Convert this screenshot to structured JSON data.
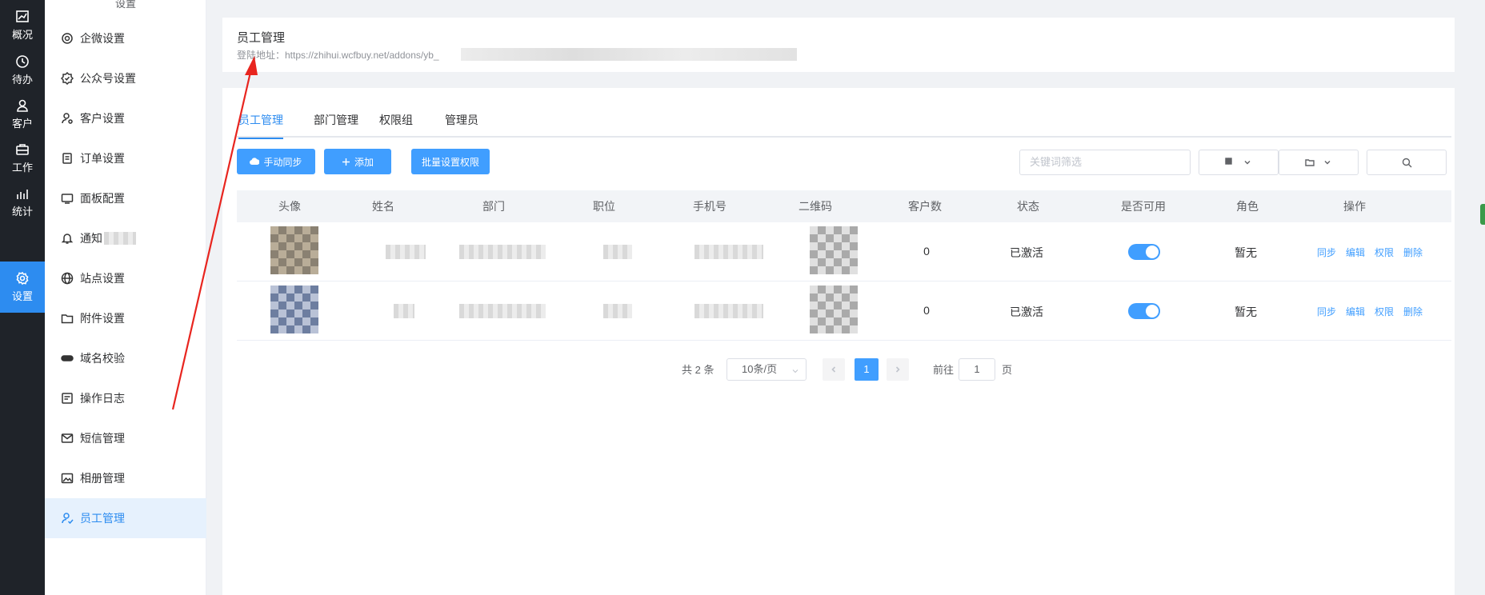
{
  "rail": {
    "items": [
      {
        "label": "概况",
        "icon": "chart-line-icon"
      },
      {
        "label": "待办",
        "icon": "clock-icon"
      },
      {
        "label": "客户",
        "icon": "user-icon"
      },
      {
        "label": "工作",
        "icon": "briefcase-icon"
      },
      {
        "label": "统计",
        "icon": "bar-chart-icon"
      },
      {
        "label": "设置",
        "icon": "gear-icon",
        "active": true
      }
    ]
  },
  "menu": {
    "top_label": "设置",
    "items": [
      {
        "label": "企微设置",
        "icon": "wecom-icon"
      },
      {
        "label": "公众号设置",
        "icon": "check-badge-icon"
      },
      {
        "label": "客户设置",
        "icon": "user-gear-icon"
      },
      {
        "label": "订单设置",
        "icon": "order-doc-icon"
      },
      {
        "label": "面板配置",
        "icon": "panel-icon"
      },
      {
        "label": "通知",
        "icon": "bell-icon"
      },
      {
        "label": "站点设置",
        "icon": "globe-icon"
      },
      {
        "label": "附件设置",
        "icon": "folder-icon"
      },
      {
        "label": "域名校验",
        "icon": "domain-icon"
      },
      {
        "label": "操作日志",
        "icon": "log-icon"
      },
      {
        "label": "短信管理",
        "icon": "sms-icon"
      },
      {
        "label": "相册管理",
        "icon": "album-icon"
      },
      {
        "label": "员工管理",
        "icon": "staff-icon",
        "active": true
      }
    ]
  },
  "header": {
    "title": "员工管理",
    "login_label": "登陆地址：https://zhihui.wcfbuy.net/addons/yb_"
  },
  "tabs": [
    "员工管理",
    "部门管理",
    "权限组",
    "管理员"
  ],
  "toolbar": {
    "sync_label": "手动同步",
    "add_label": "添加",
    "batch_label": "批量设置权限",
    "search_placeholder": "关键词筛选"
  },
  "table": {
    "columns": [
      "头像",
      "姓名",
      "部门",
      "职位",
      "手机号",
      "二维码",
      "客户数",
      "状态",
      "是否可用",
      "角色",
      "操作"
    ],
    "rows": [
      {
        "customers": "0",
        "status": "已激活",
        "enabled": true,
        "role": "暂无"
      },
      {
        "customers": "0",
        "status": "已激活",
        "enabled": true,
        "role": "暂无"
      }
    ],
    "actions": [
      "同步",
      "编辑",
      "权限",
      "删除"
    ]
  },
  "pagination": {
    "total": "共 2 条",
    "page_size": "10条/页",
    "current": "1",
    "goto_label": "前往",
    "goto_value": "1",
    "page_suffix": "页"
  },
  "colors": {
    "accent": "#409eff",
    "rail_bg": "#1f2329",
    "annotation": "#e8251f"
  }
}
